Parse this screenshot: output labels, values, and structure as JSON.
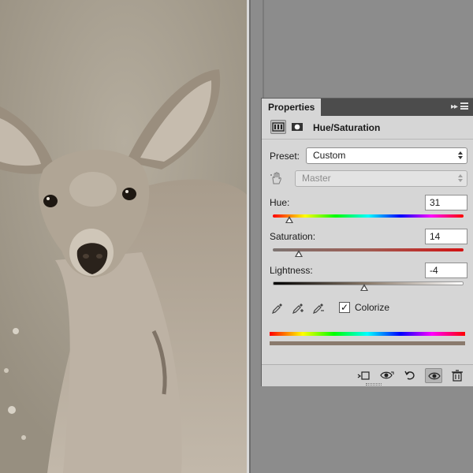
{
  "panel": {
    "tab_label": "Properties",
    "menu_glyph": "▸▸",
    "adjustment_title": "Hue/Saturation",
    "adjustment_icon": "hue-saturation-icon",
    "mask_icon": "mask-icon"
  },
  "preset": {
    "label": "Preset:",
    "value": "Custom"
  },
  "channel": {
    "value": "Master",
    "disabled": true,
    "icon": "targeted-adjustment-hand-icon"
  },
  "hue": {
    "label": "Hue:",
    "value": "31",
    "slider_fraction": 0.09
  },
  "saturation": {
    "label": "Saturation:",
    "value": "14",
    "slider_fraction": 0.14
  },
  "lightness": {
    "label": "Lightness:",
    "value": "-4",
    "slider_fraction": 0.48
  },
  "eyedroppers": [
    "eyedropper-icon",
    "eyedropper-plus-icon",
    "eyedropper-minus-icon"
  ],
  "colorize": {
    "label": "Colorize",
    "checked": true,
    "check_glyph": "✓"
  },
  "result_color": "#8a7a6d",
  "footer": {
    "buttons": [
      "clip-to-layer-icon",
      "view-previous-state-icon",
      "reset-icon",
      "visibility-eye-icon",
      "trash-icon"
    ]
  }
}
